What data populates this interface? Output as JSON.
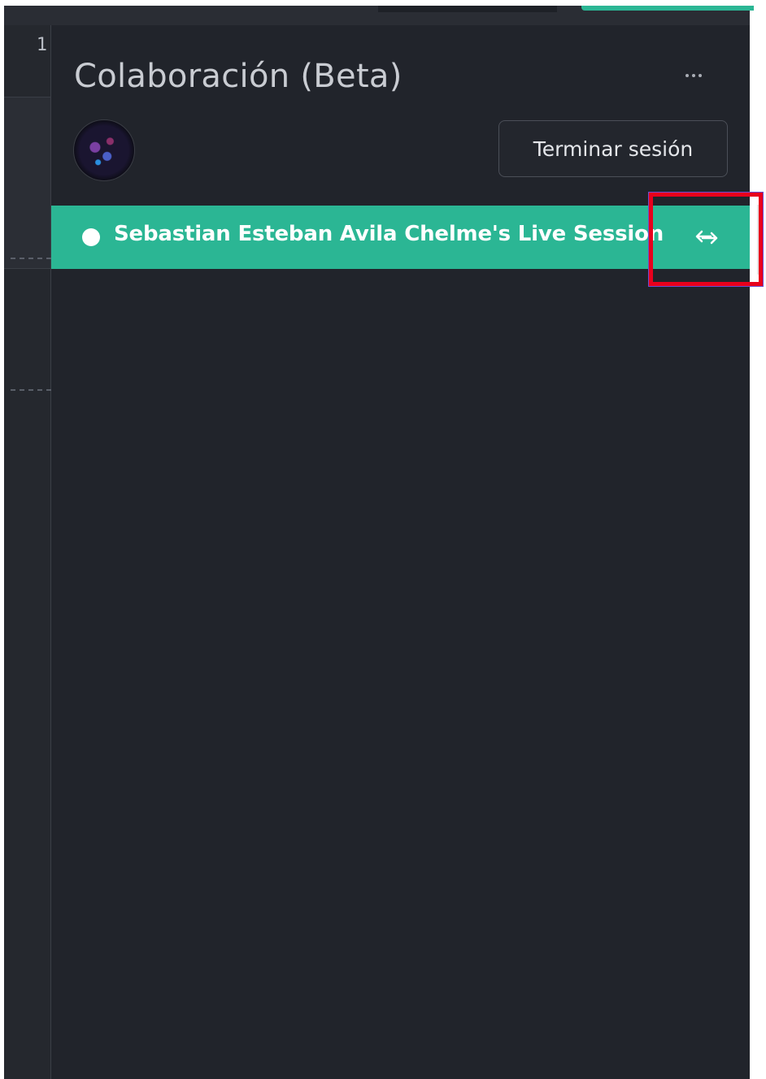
{
  "editor": {
    "line_number": "1"
  },
  "panel": {
    "title": "Colaboración (Beta)",
    "more_icon": "more-horizontal-icon",
    "avatar": "user-avatar",
    "end_session_label": "Terminar sesión"
  },
  "session": {
    "label": "Sebastian Esteban Avila Chelme's Live Session",
    "status_icon": "status-dot-icon",
    "action_icon": "swap-arrows-icon"
  },
  "colors": {
    "accent": "#2bb694",
    "panel_bg": "#21242b",
    "highlight": "#e8001c"
  }
}
